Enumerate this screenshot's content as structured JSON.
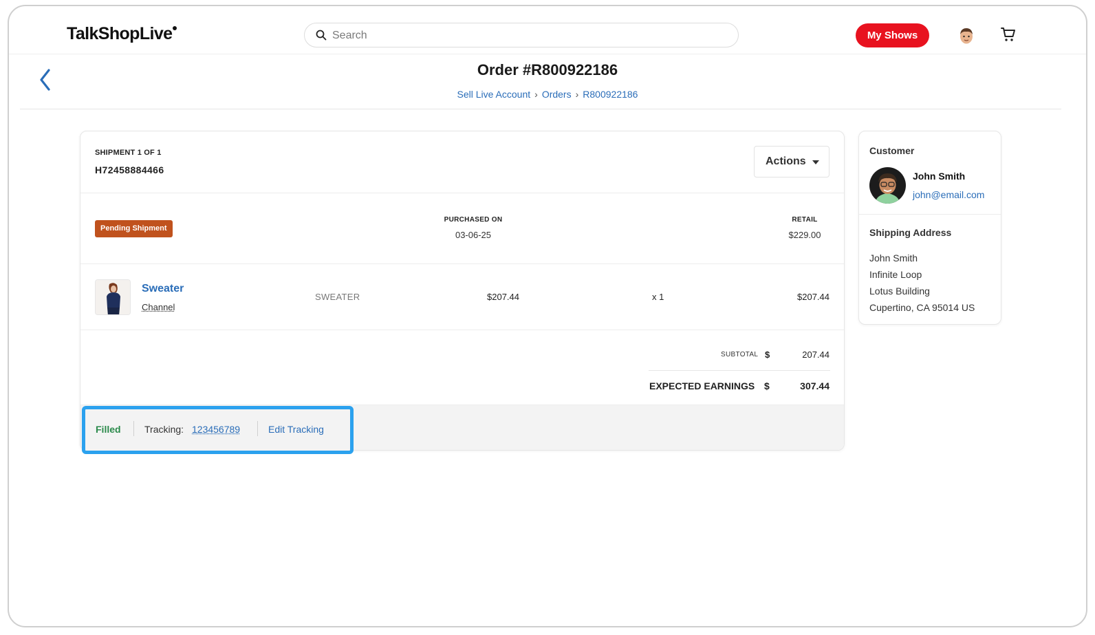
{
  "header": {
    "logo": "TalkShopLive",
    "search_placeholder": "Search",
    "my_shows_label": "My Shows"
  },
  "order": {
    "title": "Order #R800922186",
    "breadcrumb": [
      "Sell Live Account",
      "Orders",
      "R800922186"
    ]
  },
  "shipment": {
    "label": "SHIPMENT 1 OF 1",
    "id": "H72458884466",
    "actions_label": "Actions",
    "status_badge": "Pending Shipment",
    "purchased_on_label": "PURCHASED ON",
    "purchased_on": "03-06-25",
    "retail_label": "RETAIL",
    "retail": "$229.00"
  },
  "line_item": {
    "name": "Sweater",
    "channel": "Channel",
    "sku": "SWEATER",
    "unit_price": "$207.44",
    "quantity": "x 1",
    "total": "$207.44"
  },
  "summary": {
    "subtotal_label": "SUBTOTAL",
    "currency": "$",
    "subtotal": "207.44",
    "earnings_label": "EXPECTED EARNINGS",
    "earnings": "307.44"
  },
  "fulfillment": {
    "status": "Filled",
    "tracking_label": "Tracking:",
    "tracking_number": "123456789",
    "edit_label": "Edit Tracking"
  },
  "customer": {
    "title": "Customer",
    "name": "John Smith",
    "email": "john@email.com",
    "shipping_title": "Shipping Address",
    "address": [
      "John Smith",
      "Infinite Loop",
      "Lotus Building",
      "Cupertino, CA 95014 US"
    ]
  },
  "colors": {
    "brand_red": "#e8121f",
    "link_blue": "#2a6db8",
    "badge_orange": "#c0521d",
    "filled_green": "#2b8a4b",
    "highlight_blue": "#2ba1ee"
  }
}
